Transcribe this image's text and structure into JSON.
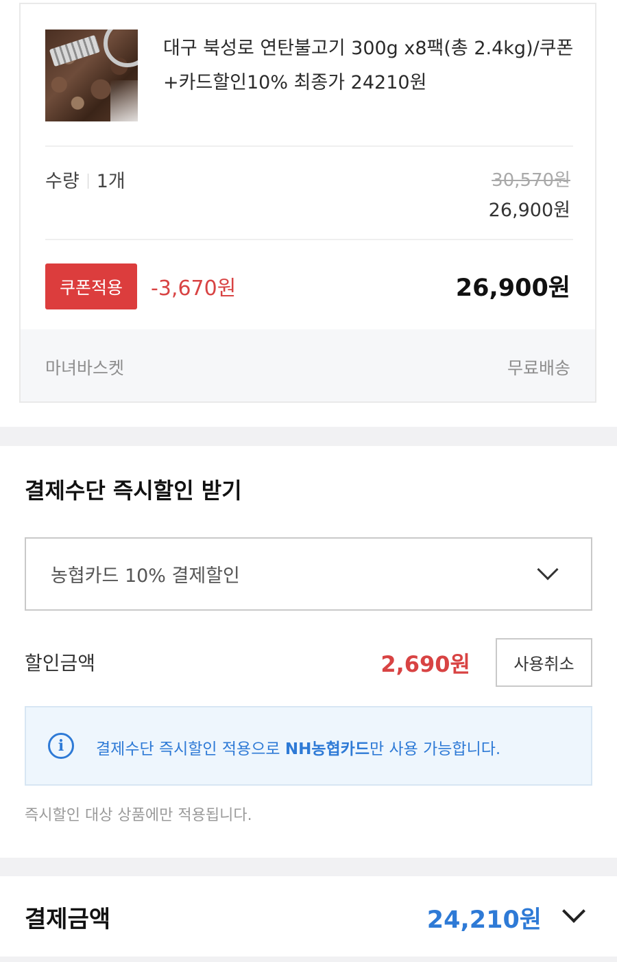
{
  "product": {
    "image_alt": "연탄불고기",
    "title": "대구 북성로 연탄불고기 300g x8팩(총 2.4kg)/쿠폰+카드할인10% 최종가 24210원",
    "quantity_label": "수량",
    "quantity_value": "1개",
    "original_price": "30,570원",
    "sale_price": "26,900원",
    "coupon_button": "쿠폰적용",
    "coupon_discount": "-3,670원",
    "item_total": "26,900원",
    "seller": "마녀바스켓",
    "shipping": "무료배송"
  },
  "instant_discount": {
    "title": "결제수단 즉시할인 받기",
    "selected_option": "농협카드 10% 결제할인",
    "discount_label": "할인금액",
    "discount_amount": "2,690원",
    "cancel_button": "사용취소",
    "info_prefix": "결제수단 즉시할인 적용으로 ",
    "info_highlight": "NH농협카드",
    "info_suffix": "만 사용 가능합니다.",
    "note": "즉시할인 대상 상품에만 적용됩니다."
  },
  "payment": {
    "title": "결제금액",
    "amount": "24,210원"
  },
  "colors": {
    "accent_red": "#dc3d3d",
    "accent_blue": "#2e7ad6",
    "info_bg": "#eef6fd"
  }
}
